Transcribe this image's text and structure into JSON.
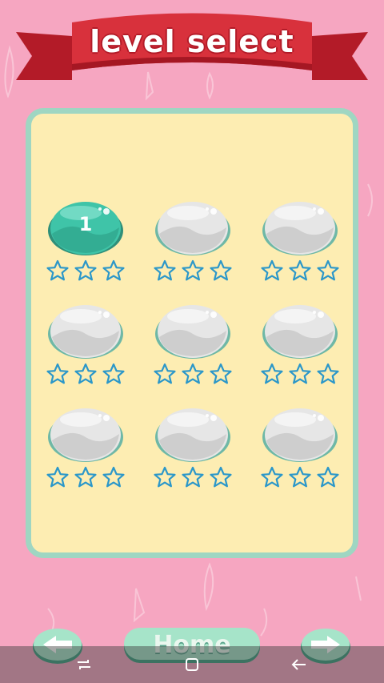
{
  "header": {
    "title": "level select"
  },
  "levels": [
    {
      "label": "1",
      "unlocked": true,
      "stars": 0
    },
    {
      "label": "",
      "unlocked": false,
      "stars": 0
    },
    {
      "label": "",
      "unlocked": false,
      "stars": 0
    },
    {
      "label": "",
      "unlocked": false,
      "stars": 0
    },
    {
      "label": "",
      "unlocked": false,
      "stars": 0
    },
    {
      "label": "",
      "unlocked": false,
      "stars": 0
    },
    {
      "label": "",
      "unlocked": false,
      "stars": 0
    },
    {
      "label": "",
      "unlocked": false,
      "stars": 0
    },
    {
      "label": "",
      "unlocked": false,
      "stars": 0
    }
  ],
  "footer": {
    "home_label": "Home",
    "prev_icon": "arrow-left-icon",
    "next_icon": "arrow-right-icon"
  },
  "system_nav": {
    "icons": [
      "recent-apps-icon",
      "home-square-icon",
      "back-icon"
    ]
  },
  "colors": {
    "background": "#f6a6c1",
    "board": "#fdedb2",
    "board_border": "#9fd6c2",
    "ribbon": "#d8313c",
    "unlocked_bubble": "#3fc4a8",
    "locked_bubble": "#e6e6e6",
    "star_outline": "#2b97c9"
  }
}
